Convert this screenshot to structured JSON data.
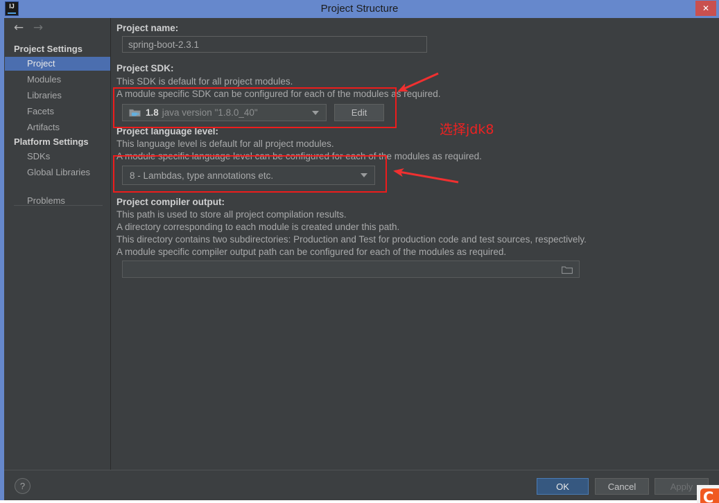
{
  "window": {
    "title": "Project Structure",
    "app_icon_label": "IJ",
    "close_label": "✕"
  },
  "nav": {
    "back_icon": "←",
    "forward_icon": "→"
  },
  "sidebar": {
    "groups": [
      {
        "header": "Project Settings",
        "items": [
          {
            "label": "Project",
            "selected": true
          },
          {
            "label": "Modules",
            "selected": false
          },
          {
            "label": "Libraries",
            "selected": false
          },
          {
            "label": "Facets",
            "selected": false
          },
          {
            "label": "Artifacts",
            "selected": false
          }
        ]
      },
      {
        "header": "Platform Settings",
        "items": [
          {
            "label": "SDKs",
            "selected": false
          },
          {
            "label": "Global Libraries",
            "selected": false
          }
        ]
      }
    ],
    "problems": {
      "label": "Problems"
    }
  },
  "main": {
    "project_name": {
      "label": "Project name:",
      "value": "spring-boot-2.3.1"
    },
    "project_sdk": {
      "label": "Project SDK:",
      "desc1": "This SDK is default for all project modules.",
      "desc2": "A module specific SDK can be configured for each of the modules as required.",
      "selected_version": "1.8",
      "selected_detail": "java version \"1.8.0_40\"",
      "edit_button": "Edit"
    },
    "language_level": {
      "label": "Project language level:",
      "desc1": "This language level is default for all project modules.",
      "desc2": "A module specific language level can be configured for each of the modules as required.",
      "selected": "8 - Lambdas, type annotations etc."
    },
    "compiler_output": {
      "label": "Project compiler output:",
      "desc1": "This path is used to store all project compilation results.",
      "desc2": "A directory corresponding to each module is created under this path.",
      "desc3": "This directory contains two subdirectories: Production and Test for production code and test sources, respectively.",
      "desc4": "A module specific compiler output path can be configured for each of the modules as required.",
      "value": "",
      "browse_icon": "folder-icon"
    }
  },
  "footer": {
    "help": "?",
    "ok": "OK",
    "cancel": "Cancel",
    "apply": "Apply"
  },
  "annotations": {
    "note_text": "选择jdk8",
    "color": "#ee2222"
  },
  "colors": {
    "titlebar": "#6688cc",
    "dialog_bg": "#3c3f41",
    "selection": "#4b6eaf",
    "primary_button": "#365880",
    "close_button": "#c9504f",
    "annotation_red": "#ee1c1c"
  }
}
